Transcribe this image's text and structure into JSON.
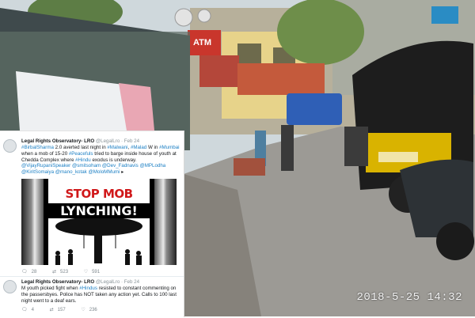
{
  "photo": {
    "timestamp": "2018-5-25 14:32",
    "sign_atm": "ATM"
  },
  "tweets": [
    {
      "name": "Legal Rights Observatory- LRO",
      "handle": "@LegalLro",
      "date": "Feb 24",
      "body": [
        {
          "t": "#BirbalSharma",
          "h": true
        },
        {
          "t": " 2.0 averted last night in ",
          "h": false
        },
        {
          "t": "#Malwani",
          "h": true
        },
        {
          "t": ", ",
          "h": false
        },
        {
          "t": "#Malad",
          "h": true
        },
        {
          "t": " W in ",
          "h": false
        },
        {
          "t": "#Mumbai",
          "h": true
        },
        {
          "t": " when a mob of 15-20 ",
          "h": false
        },
        {
          "t": "#Peacefuls",
          "h": true
        },
        {
          "t": " tried to barge inside house of youth at Chedda Complex where ",
          "h": false
        },
        {
          "t": "#Hindu",
          "h": true
        },
        {
          "t": " exodus is underway. ",
          "h": false
        },
        {
          "t": "@VijayRupaniSpeaker",
          "h": true
        },
        {
          "t": " ",
          "h": false
        },
        {
          "t": "@smitsoham",
          "h": true
        },
        {
          "t": " ",
          "h": false
        },
        {
          "t": "@Dev_Fadnavis",
          "h": true
        },
        {
          "t": " ",
          "h": false
        },
        {
          "t": "@MPLodha",
          "h": true
        },
        {
          "t": " ",
          "h": false
        },
        {
          "t": "@KiritSomaiya",
          "h": true
        },
        {
          "t": " ",
          "h": false
        },
        {
          "t": "@mano_kotak",
          "h": true
        },
        {
          "t": " ",
          "h": false
        },
        {
          "t": "@MoloMMumi",
          "h": true
        },
        {
          "t": " ▸",
          "h": false
        }
      ],
      "poster_line1": "STOP MOB",
      "poster_line2": "LYNCHING!",
      "replies": "28",
      "retweets": "523",
      "likes": "591"
    },
    {
      "name": "Legal Rights Observatory- LRO",
      "handle": "@LegalLro",
      "date": "Feb 24",
      "body": [
        {
          "t": "M youth picked fight when ",
          "h": false
        },
        {
          "t": "#Hindus",
          "h": true
        },
        {
          "t": " resisted to constant commenting on the passersbyes. Police has NOT taken any action yet. Calls to 100 last night went to a deaf ears.",
          "h": false
        }
      ],
      "replies": "4",
      "retweets": "157",
      "likes": "236"
    }
  ],
  "colors": {
    "link": "#1b7fc4",
    "poster_red": "#d0181a",
    "rickshaw_yellow": "#d9b300"
  }
}
